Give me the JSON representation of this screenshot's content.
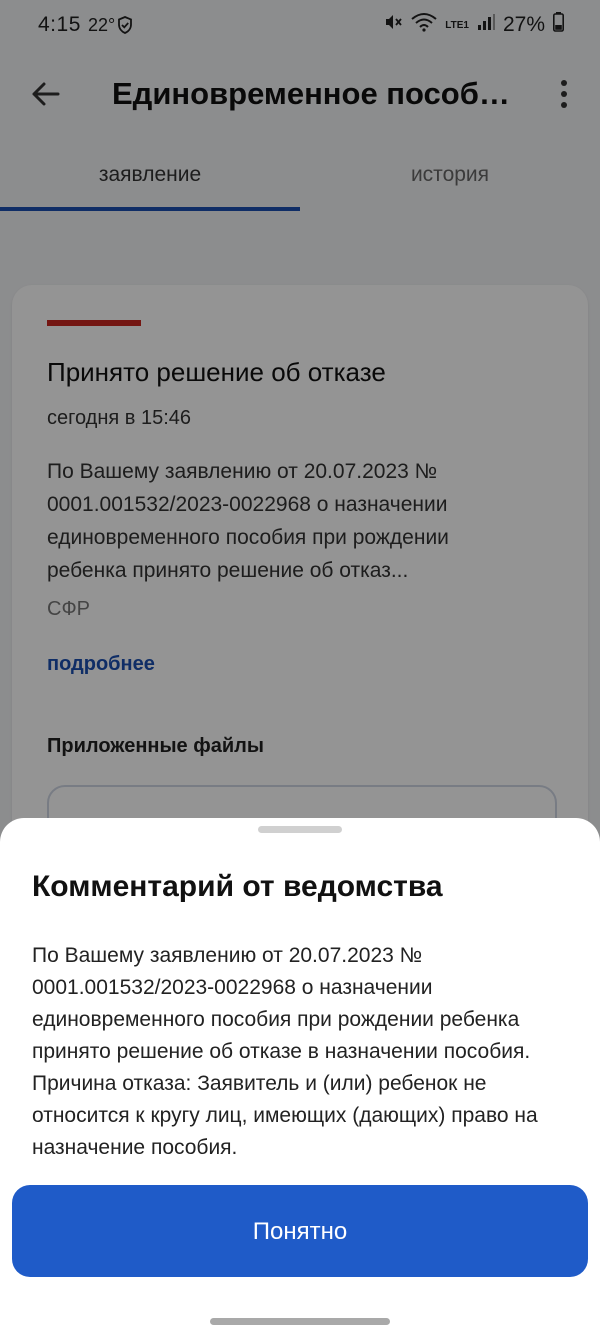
{
  "status_bar": {
    "time": "4:15",
    "temperature": "22°",
    "battery": "27%",
    "network": "LTE1"
  },
  "app_bar": {
    "title": "Единовременное пособи..."
  },
  "tabs": [
    {
      "label": "заявление",
      "active": true
    },
    {
      "label": "история",
      "active": false
    }
  ],
  "card": {
    "title": "Принято решение об отказе",
    "date": "сегодня в 15:46",
    "text": "По Вашему заявлению от 20.07.2023 № 0001.001532/2023-0022968 о назначении единовременного пособия при рождении ребенка принято решение об отказ...",
    "org": "СФР",
    "more_link": "подробнее",
    "files_title": "Приложенные файлы"
  },
  "sheet": {
    "title": "Комментарий от ведомства",
    "text": "По Вашему заявлению от 20.07.2023 № 0001.001532/2023-0022968 о назначении единовременного пособия при рождении ребенка принято решение об отказе в назначении пособия. Причина отказа: Заявитель и (или) ребенок не относится к кругу лиц, имеющих (дающих) право на назначение пособия.",
    "button_label": "Понятно"
  },
  "colors": {
    "accent": "#1a4fb0",
    "button": "#1f5bc8",
    "status_red": "#c8271f"
  }
}
